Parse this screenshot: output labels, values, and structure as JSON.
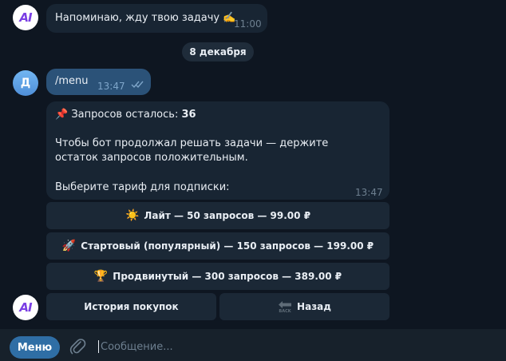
{
  "messages": {
    "bot_first": {
      "text": "Напоминаю, жду твою задачу ✍️",
      "time": "11:00"
    },
    "date_separator": "8 декабря",
    "user_menu": {
      "avatar_letter": "Д",
      "text": "/menu",
      "time": "13:47"
    },
    "bot_menu": {
      "pin_emoji": "📌",
      "requests_label": "Запросов осталось:",
      "requests_value": "36",
      "paragraph": "Чтобы бот продолжал решать задачи — держите остаток запросов положительным.",
      "prompt": "Выберите тариф для подписки:",
      "time": "13:47"
    }
  },
  "bot_avatar_text": "AI",
  "keyboard": {
    "lite": {
      "emoji": "☀️",
      "label": "Лайт — 50 запросов — 99.00 ₽"
    },
    "starter": {
      "emoji": "🚀",
      "label": "Стартовый (популярный) — 150 запросов — 199.00 ₽"
    },
    "advanced": {
      "emoji": "🏆",
      "label": "Продвинутый — 300 запросов — 389.00 ₽"
    },
    "history": {
      "label": "История покупок"
    },
    "back": {
      "icon_text": "BACK",
      "label": "Назад"
    }
  },
  "composer": {
    "menu_label": "Меню",
    "placeholder": "Сообщение..."
  },
  "colors": {
    "chat_background": "#0e1621",
    "incoming_bubble": "#182533",
    "outgoing_bubble": "#2b5278",
    "menu_button": "#2f6ea5",
    "bottom_bar": "#17212b"
  }
}
